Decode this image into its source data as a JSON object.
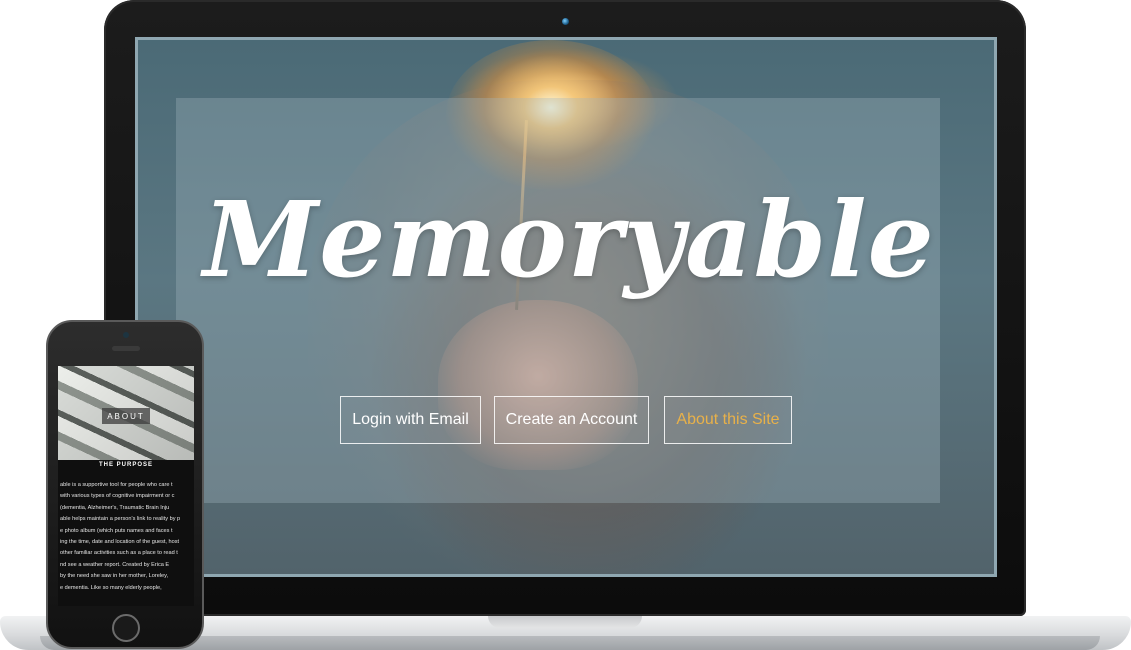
{
  "site": {
    "logo": "Memoryable",
    "buttons": {
      "login": "Login with Email",
      "create": "Create an Account",
      "about": "About this Site"
    },
    "about_color": "#e8b14a"
  },
  "phone": {
    "hero_label": "ABOUT",
    "subheading": "THE PURPOSE",
    "body_lines": [
      "able is a supportive tool for people who care t",
      "with various types of cognitive impairment or c",
      "(dementia, Alzheimer's, Traumatic Brain Inju",
      "able helps maintain a person's link to reality by p",
      "e photo album (which puts names and faces t",
      "ing the time, date and location of the guest, host",
      "other familiar activities such as a place to read t",
      "nd see a weather report. Created by Erica E",
      "by the need she saw in her mother, Loreley, ",
      "e dementia. Like so many elderly people, "
    ]
  }
}
